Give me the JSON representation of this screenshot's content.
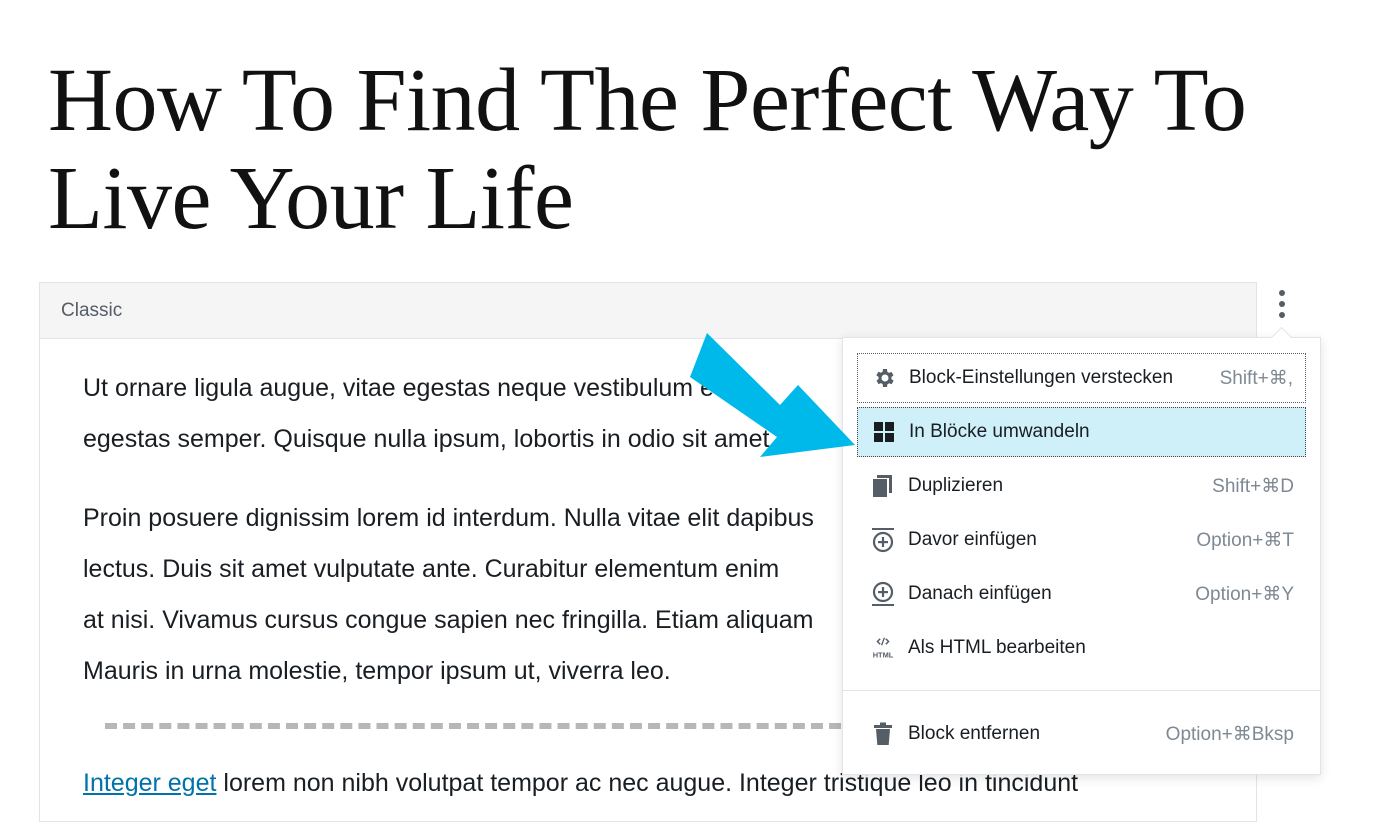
{
  "post": {
    "title": "How To Find The Perfect Way To Live Your Life"
  },
  "classic_block": {
    "label": "Classic",
    "paragraphs": [
      "Ut ornare ligula augue, vitae egestas neque vestibulum eu",
      "egestas semper. Quisque nulla ipsum, lobortis in odio sit amet",
      "Proin posuere dignissim lorem id interdum. Nulla vitae elit dapibus",
      "lectus. Duis sit amet vulputate ante. Curabitur elementum enim",
      "at nisi. Vivamus cursus congue sapien nec fringilla. Etiam aliquam",
      "Mauris in urna molestie, tempor ipsum ut, viverra leo."
    ],
    "last_link": "Integer eget",
    "last_text": " lorem non nibh volutpat tempor ac nec augue. Integer tristique leo in tincidunt"
  },
  "menu": {
    "items": [
      {
        "icon": "gear-icon",
        "label": "Block-Einstellungen verstecken",
        "shortcut": "Shift+⌘,"
      },
      {
        "icon": "blocks-grid-icon",
        "label": "In Blöcke umwandeln",
        "shortcut": ""
      },
      {
        "icon": "duplicate-icon",
        "label": "Duplizieren",
        "shortcut": "Shift+⌘D"
      },
      {
        "icon": "insert-before-icon",
        "label": "Davor einfügen",
        "shortcut": "Option+⌘T"
      },
      {
        "icon": "insert-after-icon",
        "label": "Danach einfügen",
        "shortcut": "Option+⌘Y"
      },
      {
        "icon": "html-icon",
        "label": "Als HTML bearbeiten",
        "shortcut": ""
      },
      {
        "icon": "trash-icon",
        "label": "Block entfernen",
        "shortcut": "Option+⌘Bksp"
      }
    ]
  },
  "colors": {
    "highlight": "#cfeff9",
    "arrow": "#00b9eb",
    "link": "#0073aa"
  }
}
